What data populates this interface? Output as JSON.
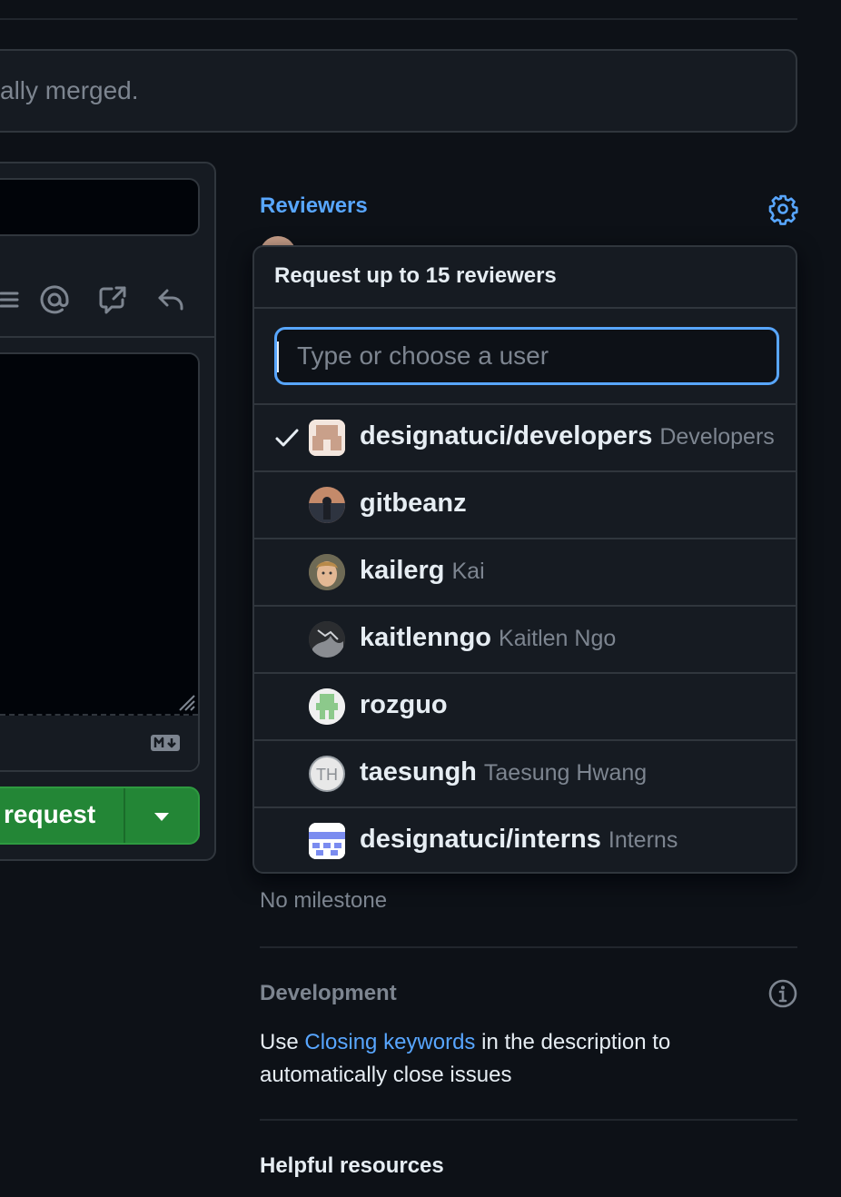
{
  "merge_notice": {
    "text": "ally merged."
  },
  "composer": {
    "submit_label": "request",
    "toolbar_icons": [
      "list-icon",
      "mention-icon",
      "cross-reference-icon",
      "reply-icon"
    ],
    "markdown_badge": "markdown-icon"
  },
  "sidebar": {
    "reviewers_heading": "Reviewers",
    "popover": {
      "title": "Request up to 15 reviewers",
      "search_placeholder": "Type or choose a user",
      "items": [
        {
          "login": "designatuci/developers",
          "name": "Developers",
          "selected": true,
          "avatar": "team-developers-avatar",
          "avatar_color": "#c9a08a"
        },
        {
          "login": "gitbeanz",
          "name": "",
          "selected": false,
          "avatar": "gitbeanz-avatar",
          "avatar_color": "#3b3f4a"
        },
        {
          "login": "kailerg",
          "name": "Kai",
          "selected": false,
          "avatar": "kailerg-avatar",
          "avatar_color": "#8a6f4e"
        },
        {
          "login": "kaitlenngo",
          "name": "Kaitlen Ngo",
          "selected": false,
          "avatar": "kaitlenngo-avatar",
          "avatar_color": "#4a4d52"
        },
        {
          "login": "rozguo",
          "name": "",
          "selected": false,
          "avatar": "rozguo-avatar",
          "avatar_color": "#8cc98b"
        },
        {
          "login": "taesungh",
          "name": "Taesung Hwang",
          "selected": false,
          "avatar": "taesungh-avatar",
          "avatar_color": "#e8e8e8"
        },
        {
          "login": "designatuci/interns",
          "name": "Interns",
          "selected": false,
          "avatar": "team-interns-avatar",
          "avatar_color": "#6e7fe0"
        }
      ]
    },
    "milestone_text": "No milestone",
    "development": {
      "heading": "Development",
      "text_before": "Use ",
      "link": "Closing keywords",
      "text_after": " in the description to automatically close issues"
    },
    "helpful_heading": "Helpful resources"
  },
  "colors": {
    "background": "#0d1117",
    "panel": "#161b22",
    "border": "#30363d",
    "accent": "#58a6ff",
    "button_green": "#238636",
    "muted": "#7d8590"
  }
}
